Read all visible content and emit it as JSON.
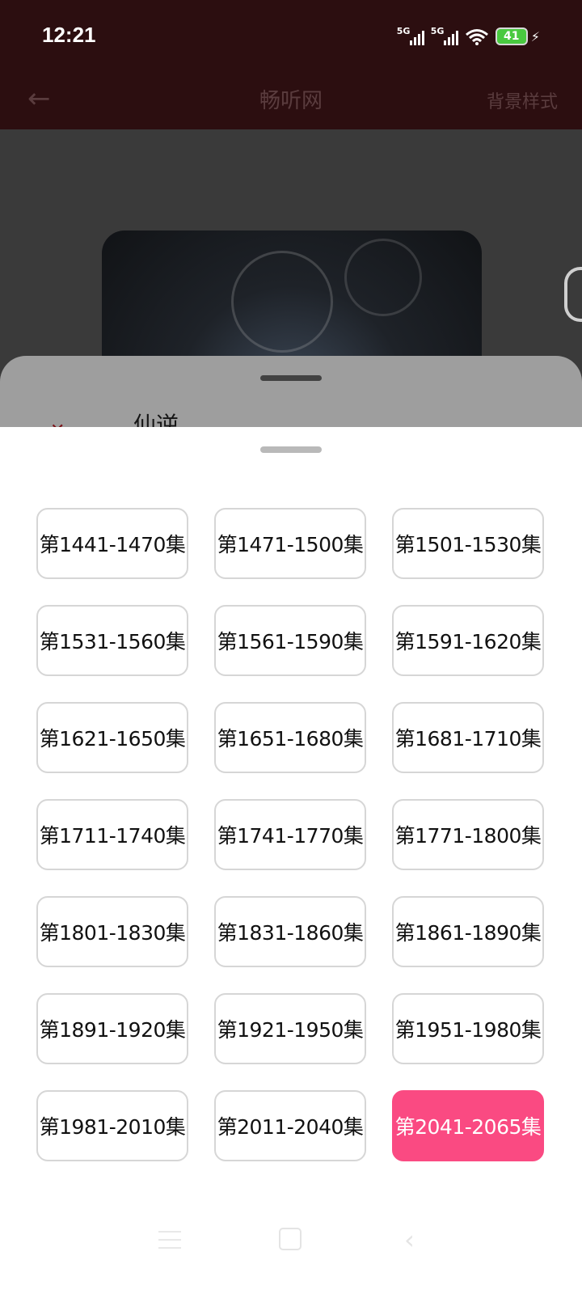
{
  "status_bar": {
    "time": "12:21",
    "network_1": "5G",
    "network_2": "5G",
    "battery": "41"
  },
  "header": {
    "title": "畅听网",
    "right_action": "背景样式"
  },
  "book": {
    "name": "仙逆"
  },
  "episodes": {
    "ranges": [
      "",
      "",
      "",
      "第1441-1470集",
      "第1471-1500集",
      "第1501-1530集",
      "第1531-1560集",
      "第1561-1590集",
      "第1591-1620集",
      "第1621-1650集",
      "第1651-1680集",
      "第1681-1710集",
      "第1711-1740集",
      "第1741-1770集",
      "第1771-1800集",
      "第1801-1830集",
      "第1831-1860集",
      "第1861-1890集",
      "第1891-1920集",
      "第1921-1950集",
      "第1951-1980集",
      "第1981-2010集",
      "第2011-2040集",
      "第2041-2065集"
    ],
    "selected_index": 23,
    "accent_color": "#fa4a82"
  },
  "colors": {
    "header_bg": "#2c0e10",
    "overlay": "#3a3a3a"
  }
}
